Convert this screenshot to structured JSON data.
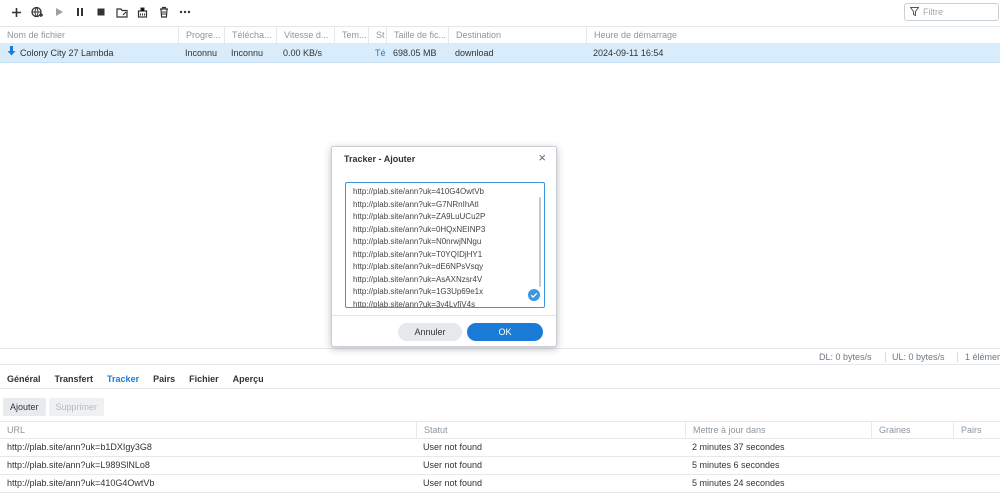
{
  "toolbar": {
    "filter_placeholder": "Filtre",
    "icons": [
      "plus-icon",
      "add-url-icon",
      "play-icon",
      "pause-icon",
      "stop-icon",
      "folder-edit-icon",
      "clean-icon",
      "trash-icon",
      "more-icon"
    ]
  },
  "main_grid": {
    "columns": [
      "Nom de fichier",
      "Progre...",
      "Téléchа...",
      "Vitesse d...",
      "Tem...",
      "St",
      "Taille de fic...",
      "Destination",
      "Heure de démarrage"
    ],
    "rows": [
      {
        "name": "Colony City 27 Lambda",
        "progress": "Inconnu",
        "uploaded": "Inconnu",
        "speed": "0.00 KB/s",
        "time": "",
        "status": "Té",
        "size": "698.05 MB",
        "destination": "download",
        "started": "2024-09-11 16:54"
      }
    ]
  },
  "statusbar": {
    "dl": "DL: 0 bytes/s",
    "ul": "UL: 0 bytes/s",
    "count": "1 élémen"
  },
  "detail_tabs": [
    "Général",
    "Transfert",
    "Tracker",
    "Pairs",
    "Fichier",
    "Aperçu"
  ],
  "detail_active_tab": "Tracker",
  "tracker_actions": {
    "add": "Ajouter",
    "delete": "Supprimer"
  },
  "tracker_grid": {
    "columns": [
      "URL",
      "Statut",
      "Mettre à jour dans",
      "Graines",
      "Pairs"
    ],
    "rows": [
      {
        "url": "http://plab.site/ann?uk=b1DXIgy3G8",
        "status": "User not found",
        "update": "2 minutes 37 secondes"
      },
      {
        "url": "http://plab.site/ann?uk=L989SlNLo8",
        "status": "User not found",
        "update": "5 minutes 6 secondes"
      },
      {
        "url": "http://plab.site/ann?uk=410G4OwtVb",
        "status": "User not found",
        "update": "5 minutes 24 secondes"
      }
    ]
  },
  "modal": {
    "title": "Tracker - Ajouter",
    "lines": [
      "http://plab.site/ann?uk=410G4OwtVb",
      "http://plab.site/ann?uk=G7NRnIhAtl",
      "http://plab.site/ann?uk=ZA9LuUCu2P",
      "http://plab.site/ann?uk=0HQxNEINP3",
      "http://plab.site/ann?uk=N0nrwjNNgu",
      "http://plab.site/ann?uk=T0YQIDjHY1",
      "http://plab.site/ann?uk=dE6NPsVsqy",
      "http://plab.site/ann?uk=AsAXNzsr4V",
      "http://plab.site/ann?uk=1G3Up69e1x",
      "http://plab.site/ann?uk=3y4LvfjV4s"
    ],
    "cancel": "Annuler",
    "ok": "OK"
  },
  "colors": {
    "accent": "#1a7cd8",
    "selected_row": "#d8ecfb"
  }
}
